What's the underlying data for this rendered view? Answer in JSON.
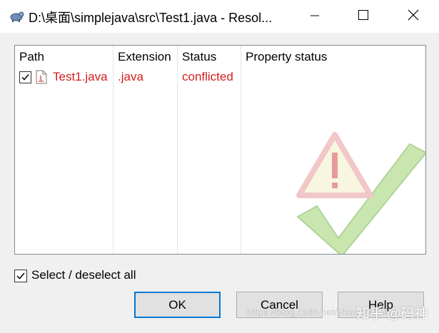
{
  "window": {
    "title": "D:\\桌面\\simplejava\\src\\Test1.java - Resol...",
    "icons": {
      "app": "tortoise-icon",
      "minimize": "minimize-icon",
      "maximize": "maximize-icon",
      "close": "close-icon"
    }
  },
  "list": {
    "columns": [
      "Path",
      "Extension",
      "Status",
      "Property status"
    ],
    "rows": [
      {
        "checked": true,
        "path": "Test1.java",
        "extension": ".java",
        "status": "conflicted",
        "property_status": "",
        "icon": "java-file-icon"
      }
    ],
    "watermark_icon": "conflict-warning-check-icon",
    "accent_color": "#d21e1e"
  },
  "select_all": {
    "checked": true,
    "label": "Select / deselect all"
  },
  "buttons": {
    "ok": "OK",
    "cancel": "Cancel",
    "help": "Help"
  },
  "overlay_watermarks": {
    "site": "https://blog.csdn.net/shuai3922415",
    "zhihu": "知乎 @码神"
  }
}
